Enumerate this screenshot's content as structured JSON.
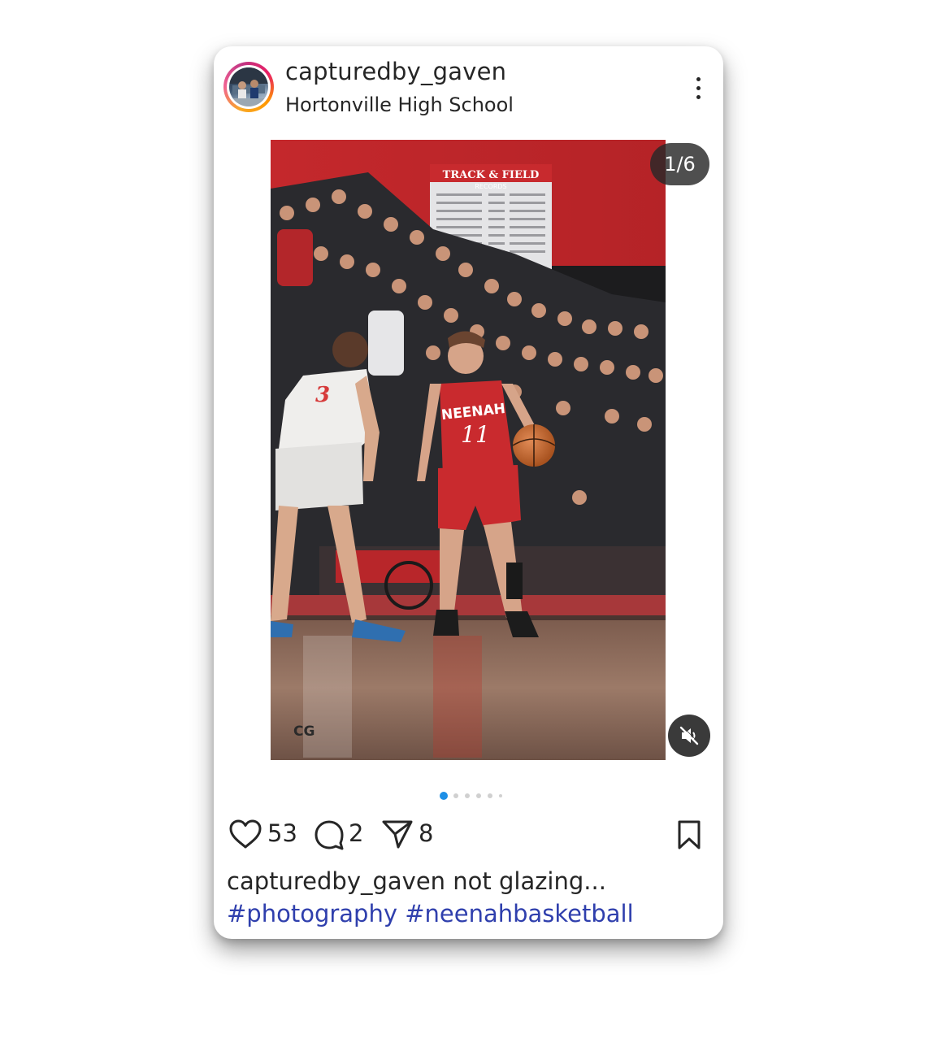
{
  "post": {
    "username": "capturedby_gaven",
    "location": "Hortonville High School",
    "media_counter": "1/6",
    "watermark": "CG",
    "likes": "53",
    "comments": "2",
    "shares": "8",
    "caption_username": "capturedby_gaven",
    "caption_text": "not glazing...",
    "hashtags": [
      "#photography",
      "#neenahbasketball"
    ],
    "carousel_total": 6,
    "carousel_active": 0
  },
  "photo_text": {
    "banner": "TRACK & FIELD",
    "banner_sub": "RECORDS",
    "jersey_team": "NEENAH",
    "jersey_number": "11",
    "defender_number": "3"
  },
  "colors": {
    "active_dot": "#1d8fe6",
    "hashtag": "#2f3fad",
    "text": "#262626"
  },
  "icons": [
    "more-vertical-icon",
    "mute-icon",
    "heart-icon",
    "comment-icon",
    "share-icon",
    "bookmark-icon"
  ]
}
